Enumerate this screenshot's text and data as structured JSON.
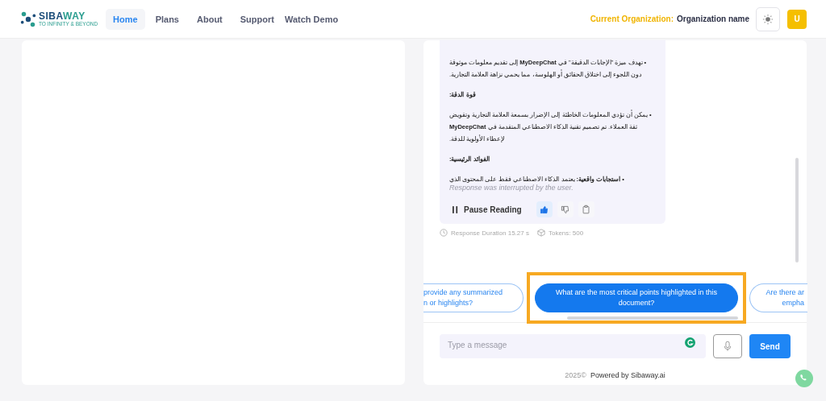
{
  "header": {
    "logo": {
      "name": "SIBA",
      "accent": "WAY",
      "tagline": "TO INFINITY & BEYOND"
    },
    "nav": [
      {
        "label": "Home",
        "selected": true
      },
      {
        "label": "Plans",
        "selected": false
      },
      {
        "label": "About",
        "selected": false
      },
      {
        "label": "Support",
        "selected": false
      },
      {
        "label": "Watch Demo",
        "selected": false
      }
    ],
    "org_label": "Current Organization:",
    "org_name": "Organization name",
    "avatar": "U"
  },
  "message": {
    "blocks": [
      {
        "kind": "bullet",
        "text": "• تهدف ميزة \"الإجابات الدقيقة\" في **MyDeepChat** إلى تقديم معلومات موثوقة دون اللجوء إلى اختلاق الحقائق أو الهلوسة، مما يحمي نزاهة العلامة التجارية."
      },
      {
        "kind": "heading",
        "text": "قوة الدقة:"
      },
      {
        "kind": "bullet",
        "text": "• يمكن أن تؤدي المعلومات الخاطئة إلى الإضرار بسمعة العلامة التجارية وتقويض ثقة العملاء. تم تصميم تقنية الذكاء الاصطناعي المتقدمة في **MyDeepChat** لإعطاء الأولوية للدقة."
      },
      {
        "kind": "heading",
        "text": "الفوائد الرئيسية:"
      },
      {
        "kind": "bullet",
        "text": "• **استجابات واقعية:** يعتمد الذكاء الاصطناعي فقط على المحتوى الذي"
      }
    ],
    "interrupted": "Response was interrupted by the user.",
    "pause_label": "Pause Reading",
    "liked": true,
    "duration": "Response Duration 15.27 s",
    "tokens": "Tokens: 500"
  },
  "suggestions": [
    {
      "lines": [
        "provide any summarized",
        "n or highlights?"
      ],
      "selected": false
    },
    {
      "lines": [
        "What are the most critical points highlighted in this",
        "document?"
      ],
      "selected": true
    },
    {
      "lines": [
        "Are there ar",
        "empha"
      ],
      "selected": false
    }
  ],
  "input": {
    "placeholder": "Type a message"
  },
  "send": "Send",
  "footer": {
    "year": "2025©",
    "powered": "Powered by Sibaway.ai"
  }
}
